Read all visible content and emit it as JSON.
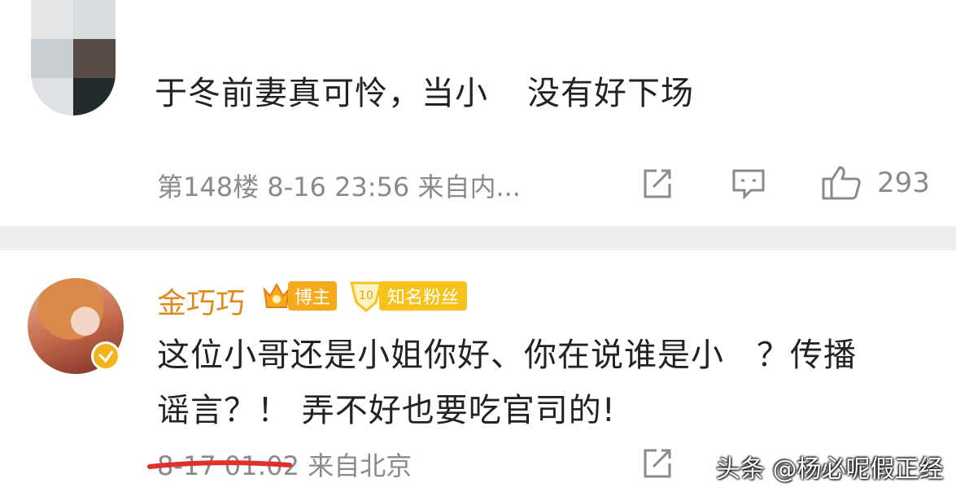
{
  "comment_1": {
    "text_part1": "于冬前妻真可怜，当小",
    "text_part2": "没有好下场",
    "floor": "第148楼",
    "time": "8-16 23:56",
    "source": "来自内...",
    "like_count": "293",
    "icons": [
      "share-icon",
      "comment-icon",
      "like-icon"
    ]
  },
  "comment_2": {
    "username": "金巧巧",
    "badge_blogger": "博主",
    "badge_fans_level": "10",
    "badge_fans": "知名粉丝",
    "line1_part1": "这位小哥还是小姐你好、你在说谁是小",
    "line1_part2": "？传播",
    "line2": "谣言？！ 弄不好也要吃官司的!",
    "time": "8-17 01:02",
    "source": "来自北京",
    "icons": [
      "share-icon"
    ]
  },
  "watermark": "头条 @杨必呢假正经",
  "colors": {
    "username": "#e08a1e",
    "meta": "#8a8a8a",
    "divider": "#efefef",
    "badge_gold": "#f7a91c",
    "underline_red": "#e0302a"
  }
}
